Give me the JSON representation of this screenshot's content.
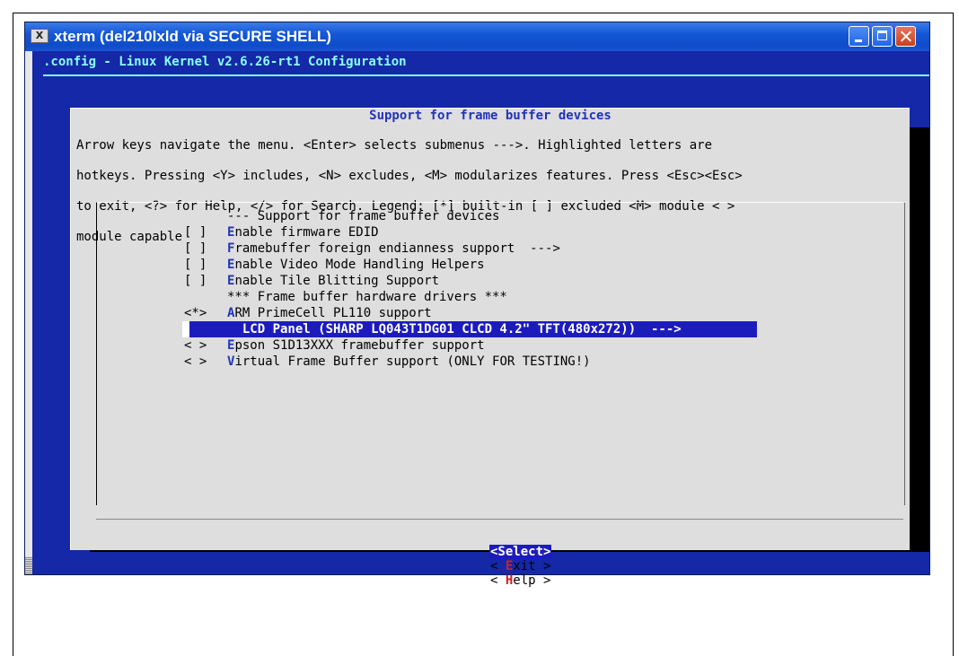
{
  "window": {
    "title": "xterm (del210lxld via SECURE SHELL)",
    "icon": "xterm-icon"
  },
  "terminal": {
    "header": ".config - Linux Kernel v2.6.26-rt1 Configuration"
  },
  "dialog": {
    "title": "Support for frame buffer devices",
    "help_lines": [
      "Arrow keys navigate the menu.  <Enter> selects submenus --->.  Highlighted letters are",
      "hotkeys.  Pressing <Y> includes, <N> excludes, <M> modularizes features.  Press <Esc><Esc>",
      "to exit, <?> for Help, </> for Search.  Legend: [*] built-in  [ ] excluded  <M> module  < >",
      "module capable"
    ]
  },
  "menu": {
    "items": [
      {
        "mark": "",
        "hot": "",
        "text": "--- Support for frame buffer devices"
      },
      {
        "mark": "[ ]",
        "hot": "E",
        "text": "nable firmware EDID"
      },
      {
        "mark": "[ ]",
        "hot": "F",
        "text": "ramebuffer foreign endianness support  --->"
      },
      {
        "mark": "[ ]",
        "hot": "E",
        "text": "nable Video Mode Handling Helpers"
      },
      {
        "mark": "[ ]",
        "hot": "E",
        "text": "nable Tile Blitting Support"
      },
      {
        "mark": "",
        "hot": "",
        "text": "*** Frame buffer hardware drivers ***"
      },
      {
        "mark": "<*>",
        "hot": "A",
        "text": "RM PrimeCell PL110 support"
      },
      {
        "mark": "",
        "hot": "",
        "text": "  LCD Panel (SHARP LQ043T1DG01 CLCD 4.2\" TFT(480x272))  --->"
      },
      {
        "mark": "< >",
        "hot": "E",
        "text": "pson S1D13XXX framebuffer support"
      },
      {
        "mark": "< >",
        "hot": "V",
        "text": "irtual Frame Buffer support (ONLY FOR TESTING!)"
      }
    ],
    "selected_index": 7
  },
  "buttons": {
    "select": {
      "open": "<",
      "hot": "S",
      "rest": "elect",
      "close": ">"
    },
    "exit": {
      "open": "< ",
      "hot": "E",
      "rest": "xit",
      "close": " >"
    },
    "help": {
      "open": "< ",
      "hot": "H",
      "rest": "elp",
      "close": " >"
    }
  },
  "colors": {
    "terminal_bg": "#1428a8",
    "dialog_bg": "#dedede",
    "highlight": "#1c1cbd",
    "hotkey": "#2233bb",
    "title_bar": "#1457d6"
  }
}
